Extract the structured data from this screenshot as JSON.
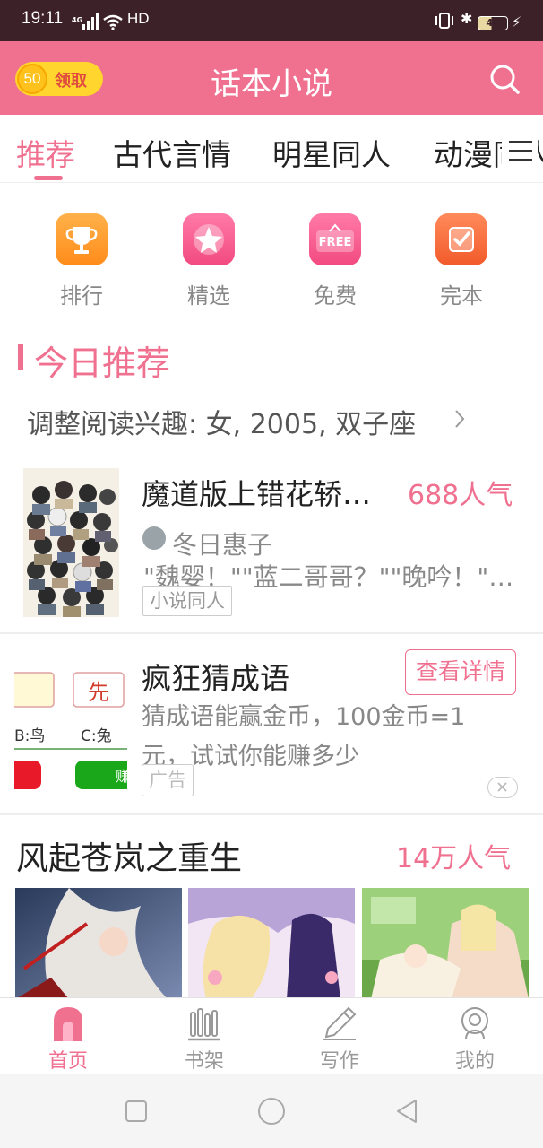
{
  "status_bar": {
    "time": "19:11",
    "network": "4G",
    "hd": "HD",
    "battery": "46"
  },
  "header": {
    "coin_value": "50",
    "claim_label": "领取",
    "title": "话本小说",
    "icon": "search-icon",
    "color": "#f07090"
  },
  "tabs": [
    {
      "label": "推荐",
      "active": true
    },
    {
      "label": "古代言情"
    },
    {
      "label": "明星同人"
    },
    {
      "label": "动漫同人"
    }
  ],
  "quick_entries": [
    {
      "label": "排行",
      "icon": "trophy-icon"
    },
    {
      "label": "精选",
      "icon": "star-icon"
    },
    {
      "label": "免费",
      "icon": "free-icon"
    },
    {
      "label": "完本",
      "icon": "check-icon"
    }
  ],
  "today": {
    "section_title": "今日推荐",
    "interest_text": "调整阅读兴趣: 女, 2005, 双子座"
  },
  "book": {
    "title": "魔道版上错花轿…",
    "popularity": "688人气",
    "author": "冬日惠子",
    "excerpt": "\"魏婴！\"\"蓝二哥哥？\"\"晚吟！\"…",
    "tag": "小说同人"
  },
  "ad": {
    "title": "疯狂猜成语",
    "button": "查看详情",
    "description": "猜成语能赢金币，100金币=1元，试试你能赚多少",
    "tag": "广告",
    "image_text": {
      "box_char": "先",
      "option_b": "B:鸟",
      "option_c": "C:兔",
      "button_char": "赚"
    }
  },
  "featured": {
    "title": "风起苍岚之重生",
    "popularity": "14万人气"
  },
  "bottom_nav": [
    {
      "label": "首页",
      "active": true,
      "icon": "home-icon"
    },
    {
      "label": "书架",
      "icon": "bookshelf-icon"
    },
    {
      "label": "写作",
      "icon": "pencil-icon"
    },
    {
      "label": "我的",
      "icon": "profile-icon"
    }
  ]
}
